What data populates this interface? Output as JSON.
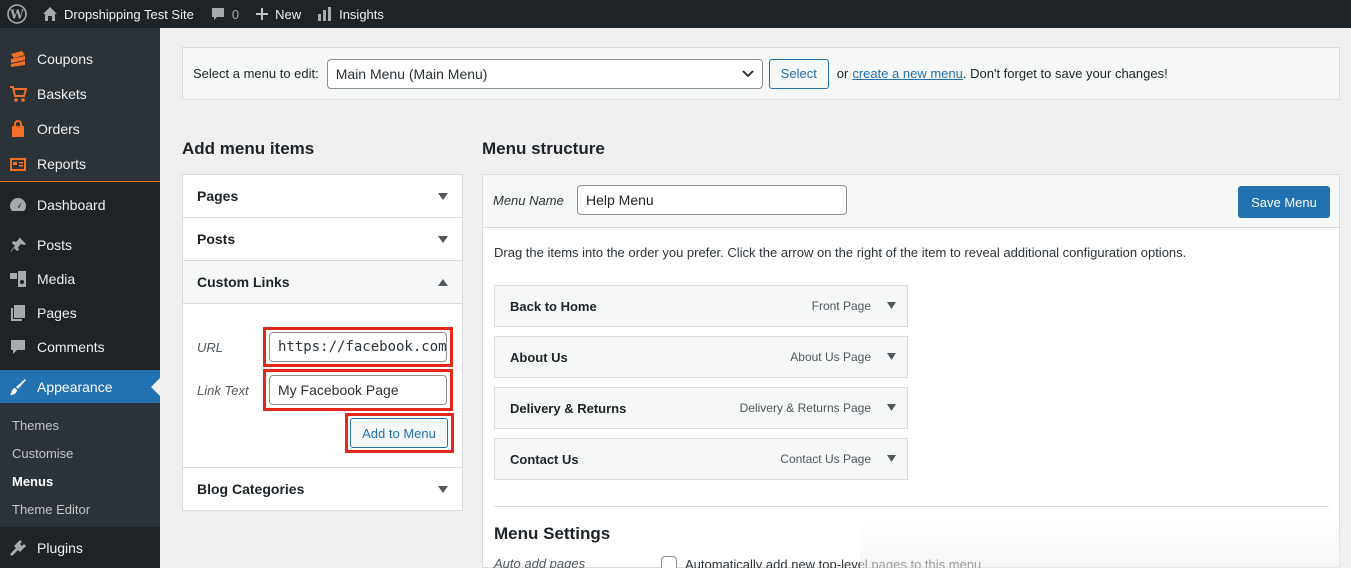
{
  "admin_bar": {
    "site_name": "Dropshipping Test Site",
    "comments_count": "0",
    "new_label": "New",
    "insights_label": "Insights"
  },
  "sidebar": {
    "woo_items": [
      "Coupons",
      "Baskets",
      "Orders",
      "Reports"
    ],
    "items": [
      "Dashboard",
      "Posts",
      "Media",
      "Pages",
      "Comments",
      "Appearance",
      "Plugins"
    ],
    "current": "Appearance",
    "appearance_submenu": [
      "Themes",
      "Customise",
      "Menus",
      "Theme Editor"
    ],
    "current_submenu": "Menus"
  },
  "manage_menus": {
    "label": "Select a menu to edit:",
    "selected": "Main Menu (Main Menu)",
    "select_button": "Select",
    "or_text": "or",
    "create_link": "create a new menu",
    "suffix": ". Don't forget to save your changes!"
  },
  "add_items": {
    "heading": "Add menu items",
    "sections": [
      "Pages",
      "Posts",
      "Custom Links",
      "Blog Categories"
    ],
    "custom_links": {
      "url_label": "URL",
      "url_value": "https://facebook.com",
      "link_text_label": "Link Text",
      "link_text_value": "My Facebook Page",
      "add_button": "Add to Menu"
    }
  },
  "menu_structure": {
    "heading": "Menu structure",
    "menu_name_label": "Menu Name",
    "menu_name_value": "Help Menu",
    "save_button": "Save Menu",
    "instructions": "Drag the items into the order you prefer. Click the arrow on the right of the item to reveal additional configuration options.",
    "items": [
      {
        "title": "Back to Home",
        "type": "Front Page"
      },
      {
        "title": "About Us",
        "type": "About Us Page"
      },
      {
        "title": "Delivery & Returns",
        "type": "Delivery & Returns Page"
      },
      {
        "title": "Contact Us",
        "type": "Contact Us Page"
      }
    ],
    "settings_title": "Menu Settings",
    "auto_add_label": "Auto add pages",
    "auto_add_text": "Automatically add new top-level pages to this menu"
  },
  "colors": {
    "admin_dark": "#1d2327",
    "accent_blue": "#2271b1",
    "woo_orange": "#f56e28",
    "highlight_red": "#e3271a"
  }
}
